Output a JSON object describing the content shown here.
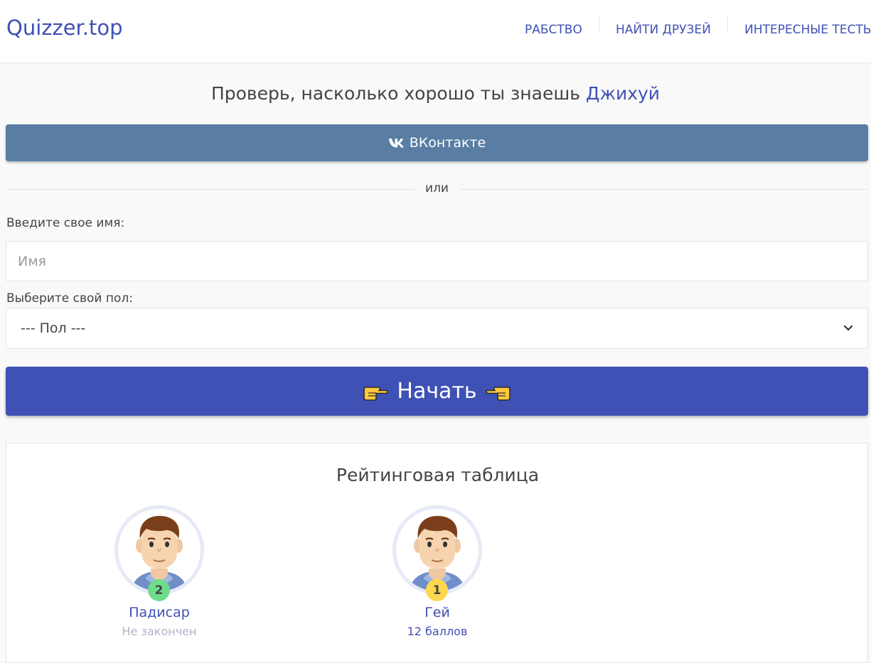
{
  "header": {
    "logo": "Quizzer.top",
    "nav": [
      {
        "label": "РАБСТВО"
      },
      {
        "label": "НАЙТИ ДРУЗЕЙ"
      },
      {
        "label": "ИНТЕРЕСНЫЕ ТЕСТЫ"
      }
    ]
  },
  "intro": {
    "prefix": "Проверь, насколько хорошо ты знаешь ",
    "name": "Джихуй"
  },
  "vk_button": {
    "label": "ВКонтакте",
    "icon": "vk-icon"
  },
  "divider": {
    "text": "или"
  },
  "name_field": {
    "label": "Введите свое имя:",
    "placeholder": "Имя",
    "value": ""
  },
  "gender_field": {
    "label": "Выберите свой пол:",
    "selected": "--- Пол ---"
  },
  "start_button": {
    "label": "Начать",
    "icons": [
      "hand-pointing-right-icon",
      "hand-pointing-left-icon"
    ]
  },
  "leaderboard": {
    "title": "Рейтинговая таблица",
    "players": [
      {
        "rank": "2",
        "name": "Падисар",
        "status": "Не закончен",
        "badge_color": "#6fdc8c",
        "status_color": "#b0b4c4"
      },
      {
        "rank": "1",
        "name": "Гей",
        "status": "12 баллов",
        "badge_color": "#ffd84d",
        "status_color": "#3f51b5"
      }
    ]
  },
  "colors": {
    "accent": "#3f51b5",
    "vk": "#597da3",
    "background": "#f9f9f9"
  }
}
